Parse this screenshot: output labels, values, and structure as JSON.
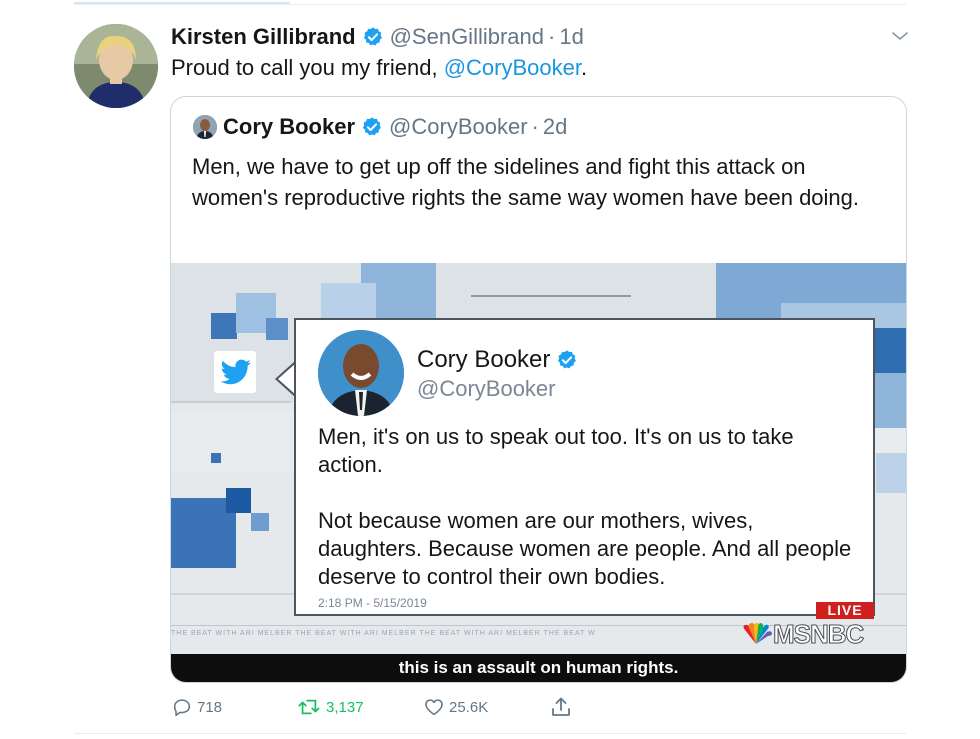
{
  "tweet": {
    "author_name": "Kirsten Gillibrand",
    "handle": "@SenGillibrand",
    "separator": "·",
    "time": "1d",
    "text_before": "Proud to call you my friend, ",
    "mention": "@CoryBooker",
    "text_after": "."
  },
  "quoted_tweet": {
    "author_name": "Cory Booker",
    "handle": "@CoryBooker",
    "separator": "·",
    "time": "2d",
    "text": "Men, we have to get up off the sidelines and fight this attack on women's reproductive rights the same way women have been doing."
  },
  "media": {
    "card": {
      "name": "Cory Booker",
      "handle": "@CoryBooker",
      "paragraph1": "Men, it's on us to speak out too. It's on us to take action.",
      "paragraph2": "Not because women are our mothers, wives, daughters. Because women are people. And all people deserve to control their own bodies.",
      "date": "2:18 PM - 5/15/2019"
    },
    "live_label": "LIVE",
    "network": "MSNBC",
    "ticker": "THE BEAT WITH ARI MELBER    THE BEAT WITH ARI MELBER    THE BEAT WITH ARI MELBER    THE BEAT W",
    "caption": "this is an assault on human rights."
  },
  "actions": {
    "replies": "718",
    "retweets": "3,137",
    "likes": "25.6K"
  },
  "colors": {
    "link": "#1b95e0",
    "verified": "#1da1f2",
    "retweet_active": "#17bf63",
    "secondary_text": "#657786",
    "live_red": "#d0201d"
  },
  "icons": [
    "verified-badge-icon",
    "chevron-down-icon",
    "twitter-bird-icon",
    "nbc-peacock-icon",
    "reply-icon",
    "retweet-icon",
    "like-icon",
    "share-icon"
  ]
}
